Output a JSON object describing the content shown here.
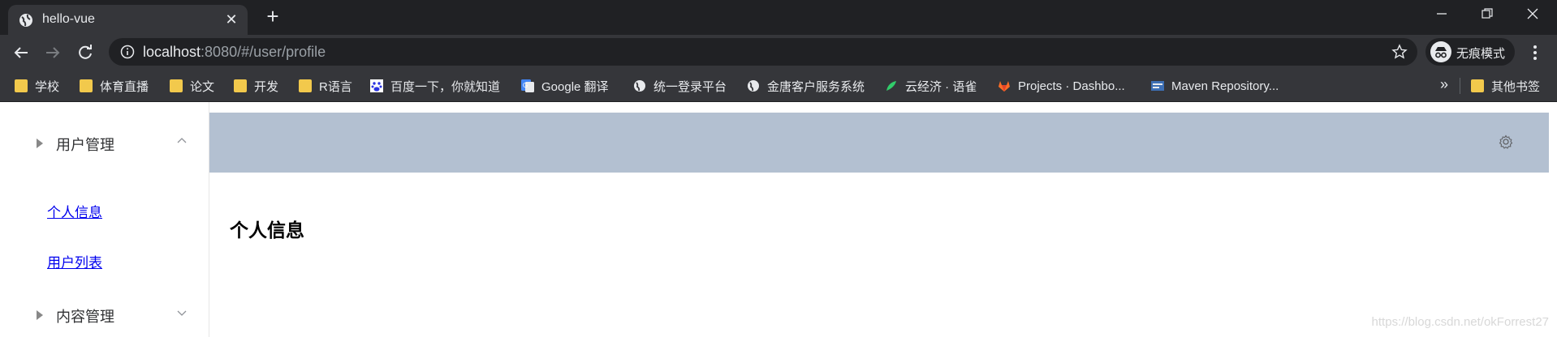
{
  "browser": {
    "tab_title": "hello-vue",
    "url_host": "localhost",
    "url_rest": ":8080/#/user/profile",
    "incognito_label": "无痕模式"
  },
  "bookmarks": [
    {
      "label": "学校",
      "icon": "folder-icon"
    },
    {
      "label": "体育直播",
      "icon": "folder-icon"
    },
    {
      "label": "论文",
      "icon": "folder-icon"
    },
    {
      "label": "开发",
      "icon": "folder-icon"
    },
    {
      "label": "R语言",
      "icon": "folder-icon"
    },
    {
      "label": "百度一下，你就知道",
      "icon": "baidu-icon"
    },
    {
      "label": "Google 翻译",
      "icon": "google-translate-icon"
    },
    {
      "label": "统一登录平台",
      "icon": "globe-icon"
    },
    {
      "label": "金唐客户服务系统",
      "icon": "globe-icon"
    },
    {
      "label": "云经济 · 语雀",
      "icon": "yuque-icon"
    },
    {
      "label": "Projects · Dashbo...",
      "icon": "gitlab-icon"
    },
    {
      "label": "Maven Repository...",
      "icon": "maven-icon"
    }
  ],
  "bookmarks_more": "»",
  "other_bookmarks": "其他书签",
  "sidebar": {
    "menu1_title": "用户管理",
    "menu1_items": [
      "个人信息",
      "用户列表"
    ],
    "menu2_title": "内容管理"
  },
  "main": {
    "title": "个人信息"
  },
  "watermark": "https://blog.csdn.net/okForrest27"
}
